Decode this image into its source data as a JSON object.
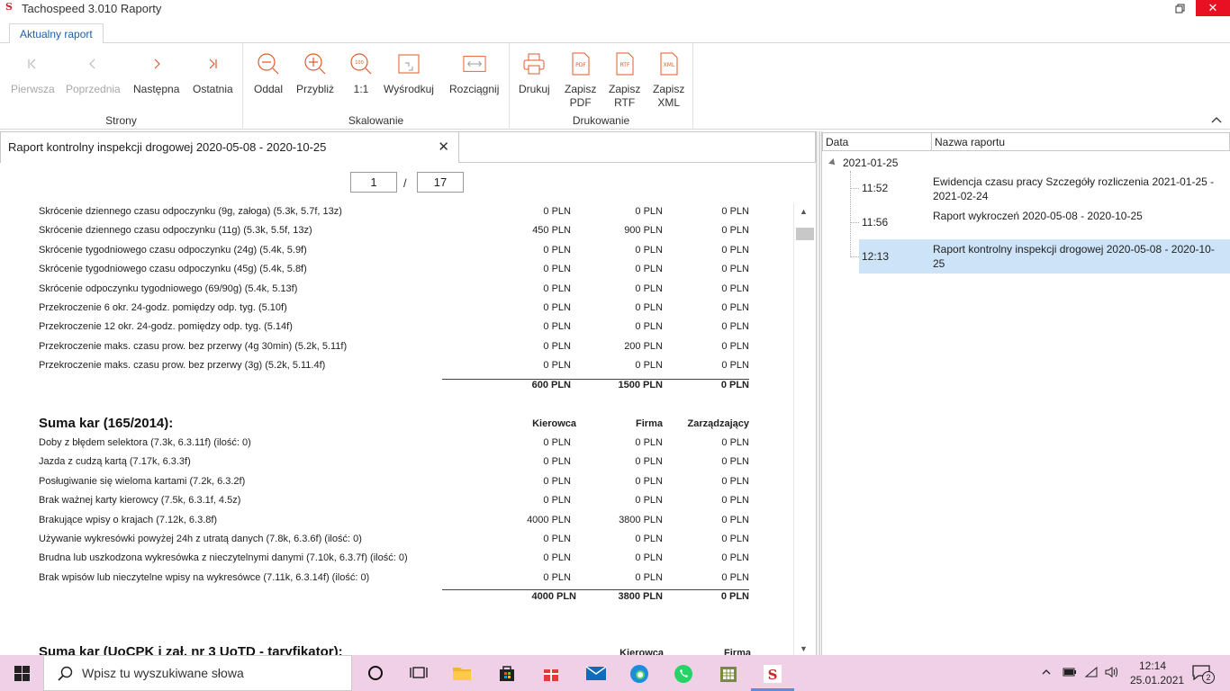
{
  "window": {
    "title": "Tachospeed 3.010 Raporty",
    "restore_icon": "restore-icon",
    "close_icon": "close-icon"
  },
  "ribbon": {
    "active_tab": "Aktualny raport",
    "groups": {
      "strony": {
        "label": "Strony",
        "buttons": [
          "Pierwsza",
          "Poprzednia",
          "Następna",
          "Ostatnia"
        ]
      },
      "skalowanie": {
        "label": "Skalowanie",
        "buttons": [
          "Oddal",
          "Przybliż",
          "1:1",
          "Wyśrodkuj",
          "Rozciągnij"
        ]
      },
      "drukowanie": {
        "label": "Drukowanie",
        "buttons": [
          "Drukuj",
          "Zapisz\nPDF",
          "Zapisz\nRTF",
          "Zapisz\nXML"
        ]
      }
    },
    "icon_texts": {
      "one_to_one": "100",
      "pdf": "PDF",
      "rtf": "RTF",
      "xml": "XML"
    }
  },
  "document_tab": {
    "title": "Raport kontrolny inspekcji drogowej 2020-05-08 - 2020-10-25"
  },
  "pager": {
    "current": "1",
    "separator": "/",
    "total": "17"
  },
  "report": {
    "rows_top": [
      {
        "label": "Skrócenie dziennego czasu odpoczynku (9g, załoga) (5.3k, 5.7f, 13z)",
        "kierowca": "0 PLN",
        "firma": "0 PLN",
        "zarz": "0 PLN"
      },
      {
        "label": "Skrócenie dziennego czasu odpoczynku (11g) (5.3k, 5.5f, 13z)",
        "kierowca": "450 PLN",
        "firma": "900 PLN",
        "zarz": "0 PLN"
      },
      {
        "label": "Skrócenie tygodniowego czasu odpoczynku (24g) (5.4k, 5.9f)",
        "kierowca": "0 PLN",
        "firma": "0 PLN",
        "zarz": "0 PLN"
      },
      {
        "label": "Skrócenie tygodniowego czasu odpoczynku (45g) (5.4k, 5.8f)",
        "kierowca": "0 PLN",
        "firma": "0 PLN",
        "zarz": "0 PLN"
      },
      {
        "label": "Skrócenie odpoczynku tygodniowego (69/90g) (5.4k, 5.13f)",
        "kierowca": "0 PLN",
        "firma": "0 PLN",
        "zarz": "0 PLN"
      },
      {
        "label": "Przekroczenie 6 okr. 24-godz. pomiędzy odp. tyg. (5.10f)",
        "kierowca": "0 PLN",
        "firma": "0 PLN",
        "zarz": "0 PLN"
      },
      {
        "label": "Przekroczenie 12 okr. 24-godz. pomiędzy odp. tyg. (5.14f)",
        "kierowca": "0 PLN",
        "firma": "0 PLN",
        "zarz": "0 PLN"
      },
      {
        "label": "Przekroczenie maks. czasu prow. bez przerwy (4g 30min) (5.2k, 5.11f)",
        "kierowca": "0 PLN",
        "firma": "200 PLN",
        "zarz": "0 PLN"
      },
      {
        "label": "Przekroczenie maks. czasu prow. bez przerwy (3g) (5.2k, 5.11.4f)",
        "kierowca": "0 PLN",
        "firma": "0 PLN",
        "zarz": "0 PLN"
      }
    ],
    "total_top": {
      "kierowca": "600 PLN",
      "firma": "1500 PLN",
      "zarz": "0 PLN"
    },
    "section2": {
      "title": "Suma kar (165/2014):",
      "col_kierowca": "Kierowca",
      "col_firma": "Firma",
      "col_zarz": "Zarządzający",
      "rows": [
        {
          "label": "Doby z błędem selektora (7.3k, 6.3.11f) (ilość: 0)",
          "kierowca": "0 PLN",
          "firma": "0 PLN",
          "zarz": "0 PLN"
        },
        {
          "label": "Jazda z cudzą kartą (7.17k, 6.3.3f)",
          "kierowca": "0 PLN",
          "firma": "0 PLN",
          "zarz": "0 PLN"
        },
        {
          "label": "Posługiwanie się wieloma kartami (7.2k, 6.3.2f)",
          "kierowca": "0 PLN",
          "firma": "0 PLN",
          "zarz": "0 PLN"
        },
        {
          "label": "Brak ważnej karty kierowcy (7.5k, 6.3.1f, 4.5z)",
          "kierowca": "0 PLN",
          "firma": "0 PLN",
          "zarz": "0 PLN"
        },
        {
          "label": "Brakujące wpisy o krajach (7.12k, 6.3.8f)",
          "kierowca": "4000 PLN",
          "firma": "3800 PLN",
          "zarz": "0 PLN"
        },
        {
          "label": "Używanie wykresówki powyżej 24h z utratą danych (7.8k, 6.3.6f) (ilość: 0)",
          "kierowca": "0 PLN",
          "firma": "0 PLN",
          "zarz": "0 PLN"
        },
        {
          "label": "Brudna lub uszkodzona wykresówka z nieczytelnymi danymi (7.10k, 6.3.7f) (ilość: 0)",
          "kierowca": "0 PLN",
          "firma": "0 PLN",
          "zarz": "0 PLN"
        },
        {
          "label": "Brak wpisów lub nieczytelne wpisy na wykresówce (7.11k, 6.3.14f) (ilość: 0)",
          "kierowca": "0 PLN",
          "firma": "0 PLN",
          "zarz": "0 PLN"
        }
      ],
      "total": {
        "kierowca": "4000 PLN",
        "firma": "3800 PLN",
        "zarz": "0 PLN"
      }
    },
    "section3": {
      "title": "Suma kar (UoCPK i zał. nr 3 UoTD - taryfikator):",
      "col_kierowca": "Kierowca",
      "col_firma": "Firma"
    }
  },
  "report_list": {
    "col_data": "Data",
    "col_name": "Nazwa raportu",
    "root_date": "2021-01-25",
    "items": [
      {
        "time": "11:52",
        "name": "Ewidencja czasu pracy Szczegóły rozliczenia 2021-01-25 - 2021-02-24"
      },
      {
        "time": "11:56",
        "name": "Raport wykroczeń 2020-05-08 - 2020-10-25"
      },
      {
        "time": "12:13",
        "name": "Raport kontrolny inspekcji drogowej 2020-05-08 - 2020-10-25"
      }
    ],
    "selected_index": 2
  },
  "taskbar": {
    "search_placeholder": "Wpisz tu wyszukiwane słowa",
    "clock_time": "12:14",
    "clock_date": "25.01.2021",
    "notification_count": "2"
  },
  "colors": {
    "accent_red": "#e05a2b",
    "selection": "#cde3f7",
    "tab_blue": "#1f5fa8",
    "taskbar": "#f0d0e6"
  }
}
